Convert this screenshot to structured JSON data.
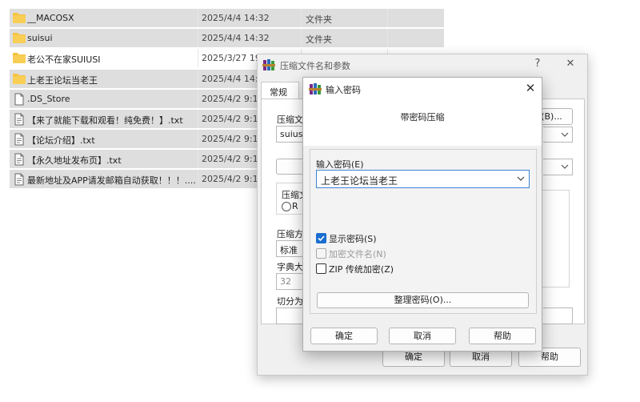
{
  "files": [
    {
      "name": "__MACOSX",
      "date": "2025/4/4 14:32",
      "type": "文件夹",
      "icon": "folder-icon",
      "selected": true
    },
    {
      "name": "suisui",
      "date": "2025/4/4 14:32",
      "type": "文件夹",
      "icon": "folder-icon",
      "selected": true
    },
    {
      "name": "老公不在家SUIUSI",
      "date": "2025/3/27 19",
      "type": "",
      "icon": "folder-icon",
      "selected": false
    },
    {
      "name": "上老王论坛当老王",
      "date": "2025/4/4 14:32",
      "type": "文件夹",
      "icon": "folder-icon",
      "selected": true
    },
    {
      "name": ".DS_Store",
      "date": "2025/4/2 9:13",
      "type": "",
      "icon": "file-icon",
      "selected": true
    },
    {
      "name": "【来了就能下载和观看！纯免费！】.txt",
      "date": "2025/4/2 9:13",
      "type": "",
      "icon": "text-file-icon",
      "selected": true
    },
    {
      "name": "【论坛介绍】.txt",
      "date": "2025/4/2 9:13",
      "type": "",
      "icon": "text-file-icon",
      "selected": true
    },
    {
      "name": "【永久地址发布页】.txt",
      "date": "2025/4/2 9:13",
      "type": "",
      "icon": "text-file-icon",
      "selected": true
    },
    {
      "name": "最新地址及APP请发邮箱自动获取！！！....",
      "date": "2025/4/2 9:13",
      "type": "",
      "icon": "text-file-icon",
      "selected": true
    }
  ],
  "archive_dialog": {
    "title": "压缩文件名和参数",
    "help_glyph": "?",
    "close_glyph": "✕",
    "tab_general": "常规",
    "archive_name_label": "压缩文",
    "archive_name_value": "suiusi.z",
    "browse_label": "(B)...",
    "format_label": "压缩文",
    "format_option": "R",
    "method_label": "压缩方",
    "method_value": "标准",
    "dict_label": "字典大",
    "dict_value": "32",
    "split_label": "切分为",
    "ok": "确定",
    "cancel": "取消",
    "help": "帮助"
  },
  "password_dialog": {
    "title": "输入密码",
    "close_glyph": "✕",
    "heading": "带密码压缩",
    "password_label": "输入密码(E)",
    "password_value": "上老王论坛当老王",
    "show_password": "显示密码(S)",
    "show_password_checked": true,
    "encrypt_names": "加密文件名(N)",
    "encrypt_names_checked": false,
    "zip_legacy": "ZIP 传统加密(Z)",
    "zip_legacy_checked": false,
    "organize_button": "整理密码(O)...",
    "ok": "确定",
    "cancel": "取消",
    "help": "帮助"
  },
  "colors": {
    "accent": "#1a6fd0",
    "folder": "#f5c342",
    "selection": "#dedede"
  }
}
